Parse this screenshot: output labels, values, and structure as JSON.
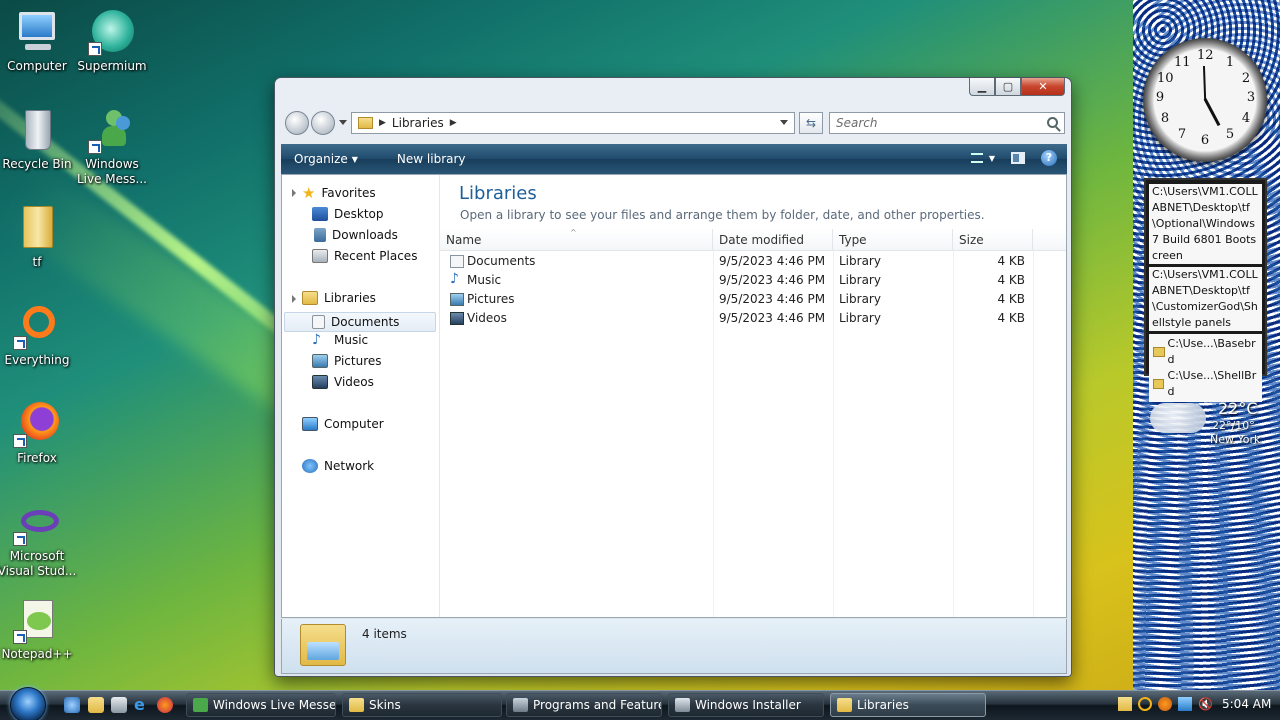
{
  "desktop": {
    "icons": [
      {
        "label": "Computer"
      },
      {
        "label": "Supermium"
      },
      {
        "label": "Recycle Bin"
      },
      {
        "label": "Windows Live Mess..."
      },
      {
        "label": "tf"
      },
      {
        "label": "Everything"
      },
      {
        "label": "Firefox"
      },
      {
        "label": "Microsoft Visual Stud..."
      },
      {
        "label": "Notepad++"
      }
    ]
  },
  "sidebar": {
    "clock_numbers": [
      "12",
      "1",
      "2",
      "3",
      "4",
      "5",
      "6",
      "7",
      "8",
      "9",
      "10",
      "11"
    ],
    "notes": [
      "C:\\Users\\VM1.COLLABNET\\Desktop\\tf\\Optional\\Windows 7 Build 6801 Bootscreen",
      "C:\\Users\\VM1.COLLABNET\\Desktop\\tf\\CustomizerGod\\Shellstyle panels"
    ],
    "files": [
      "C:\\Use...\\Basebrd",
      "C:\\Use...\\ShellBrd"
    ],
    "weather": {
      "temp": "22°C",
      "range": "22°/10°",
      "city": "New York"
    }
  },
  "window": {
    "caption_buttons": {
      "minimize": "▁",
      "maximize": "▢",
      "close": "✕"
    },
    "address": {
      "crumb": "Libraries"
    },
    "search": {
      "placeholder": "Search"
    },
    "toolbar": {
      "organize": "Organize",
      "new_library": "New library",
      "help": "?"
    },
    "nav": {
      "favorites": "Favorites",
      "favorites_items": [
        "Desktop",
        "Downloads",
        "Recent Places"
      ],
      "libraries": "Libraries",
      "libraries_items": [
        "Documents",
        "Music",
        "Pictures",
        "Videos"
      ],
      "computer": "Computer",
      "network": "Network"
    },
    "content": {
      "title": "Libraries",
      "subtitle": "Open a library to see your files and arrange them by folder, date, and other properties.",
      "columns": [
        "Name",
        "Date modified",
        "Type",
        "Size"
      ],
      "rows": [
        {
          "name": "Documents",
          "date": "9/5/2023 4:46 PM",
          "type": "Library",
          "size": "4 KB"
        },
        {
          "name": "Music",
          "date": "9/5/2023 4:46 PM",
          "type": "Library",
          "size": "4 KB"
        },
        {
          "name": "Pictures",
          "date": "9/5/2023 4:46 PM",
          "type": "Library",
          "size": "4 KB"
        },
        {
          "name": "Videos",
          "date": "9/5/2023 4:46 PM",
          "type": "Library",
          "size": "4 KB"
        }
      ]
    },
    "status": {
      "count": "4 items"
    }
  },
  "taskbar": {
    "tasks": [
      "Windows Live Messe...",
      "Skins",
      "Programs and Features",
      "Windows Installer",
      "Libraries"
    ],
    "time": "5:04 AM"
  },
  "colors": {
    "accent": "#1e5e9a",
    "toolbar": "#1f4a6c"
  }
}
